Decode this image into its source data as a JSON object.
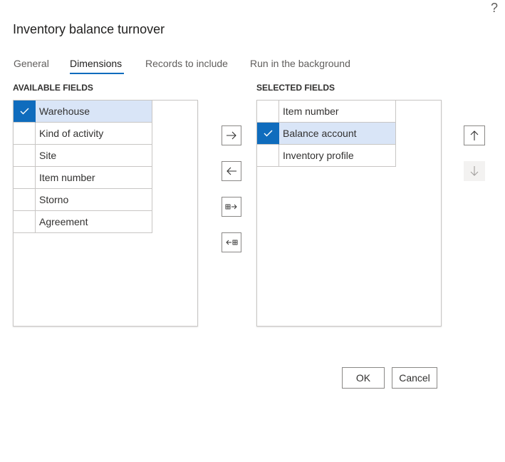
{
  "dialog": {
    "title": "Inventory balance turnover",
    "help_label": "?"
  },
  "tabs": [
    {
      "label": "General",
      "active": false
    },
    {
      "label": "Dimensions",
      "active": true
    },
    {
      "label": "Records to include",
      "active": false
    },
    {
      "label": "Run in the background",
      "active": false
    }
  ],
  "available": {
    "header": "AVAILABLE FIELDS",
    "items": [
      {
        "label": "Warehouse",
        "selected": true
      },
      {
        "label": "Kind of activity",
        "selected": false
      },
      {
        "label": "Site",
        "selected": false
      },
      {
        "label": "Item number",
        "selected": false
      },
      {
        "label": "Storno",
        "selected": false
      },
      {
        "label": "Agreement",
        "selected": false
      }
    ]
  },
  "selected": {
    "header": "SELECTED FIELDS",
    "items": [
      {
        "label": "Item number",
        "selected": false
      },
      {
        "label": "Balance account",
        "selected": true
      },
      {
        "label": "Inventory profile",
        "selected": false
      }
    ]
  },
  "move_buttons": [
    {
      "icon": "arrow-right-icon"
    },
    {
      "icon": "arrow-left-icon"
    },
    {
      "icon": "move-all-right-icon"
    },
    {
      "icon": "move-all-left-icon"
    }
  ],
  "order_buttons": [
    {
      "icon": "arrow-up-icon",
      "enabled": true
    },
    {
      "icon": "arrow-down-icon",
      "enabled": false
    }
  ],
  "footer": {
    "ok_label": "OK",
    "cancel_label": "Cancel"
  },
  "colors": {
    "accent": "#0f6cbd",
    "selection": "#d9e5f7",
    "border": "#c8c6c4"
  }
}
